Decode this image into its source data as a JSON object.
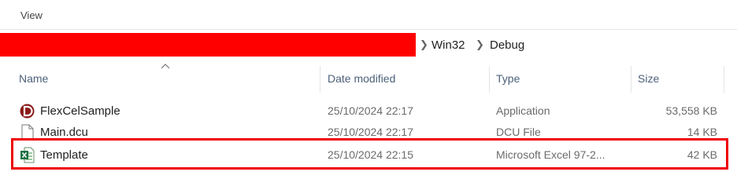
{
  "menu": {
    "view_label": "View"
  },
  "breadcrumb": {
    "items": [
      "Win32",
      "Debug"
    ]
  },
  "columns": {
    "name": "Name",
    "date": "Date modified",
    "type": "Type",
    "size": "Size"
  },
  "files": [
    {
      "name": "FlexCelSample",
      "date": "25/10/2024 22:17",
      "type": "Application",
      "size": "53,558 KB",
      "icon": "delphi-app-icon"
    },
    {
      "name": "Main.dcu",
      "date": "25/10/2024 22:17",
      "type": "DCU File",
      "size": "14 KB",
      "icon": "generic-file-icon"
    },
    {
      "name": "Template",
      "date": "25/10/2024 22:15",
      "type": "Microsoft Excel 97-2...",
      "size": "42 KB",
      "icon": "excel-file-icon"
    }
  ],
  "colors": {
    "highlight": "#ee0000",
    "redaction": "#ff0000",
    "header_text": "#4c607a",
    "excel_green": "#1d6f42",
    "delphi_red": "#8b1a1a"
  }
}
